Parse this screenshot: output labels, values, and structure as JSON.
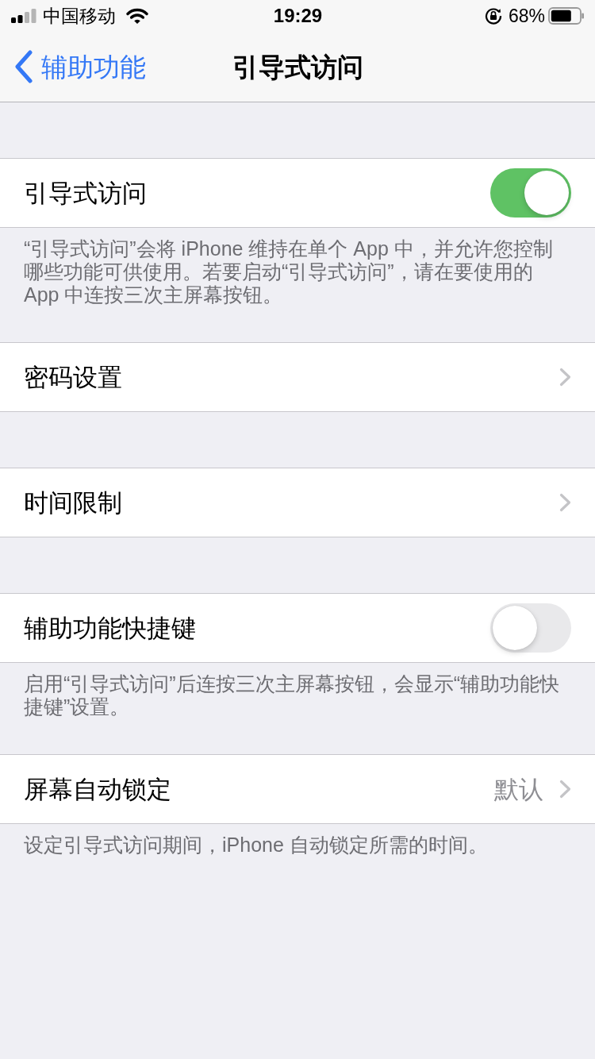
{
  "status_bar": {
    "carrier": "中国移动",
    "time": "19:29",
    "battery": "68%"
  },
  "nav_bar": {
    "back": "辅助功能",
    "title": "引导式访问"
  },
  "groups": [
    {
      "rows": [
        {
          "kind": "switch",
          "label": "引导式访问",
          "on": true
        }
      ],
      "footer": "“引导式访问”会将 iPhone 维持在单个 App 中，并允许您控制哪些功能可供使用。若要启动“引导式访问”，请在要使用的 App 中连按三次主屏幕按钮。"
    },
    {
      "rows": [
        {
          "kind": "link",
          "label": "密码设置"
        }
      ]
    },
    {
      "rows": [
        {
          "kind": "link",
          "label": "时间限制"
        }
      ]
    },
    {
      "rows": [
        {
          "kind": "switch",
          "label": "辅助功能快捷键",
          "on": false
        }
      ],
      "footer": "启用“引导式访问”后连按三次主屏幕按钮，会显示“辅助功能快捷键”设置。"
    },
    {
      "rows": [
        {
          "kind": "link",
          "label": "屏幕自动锁定",
          "value": "默认"
        }
      ],
      "footer": "设定引导式访问期间，iPhone 自动锁定所需的时间。"
    }
  ]
}
